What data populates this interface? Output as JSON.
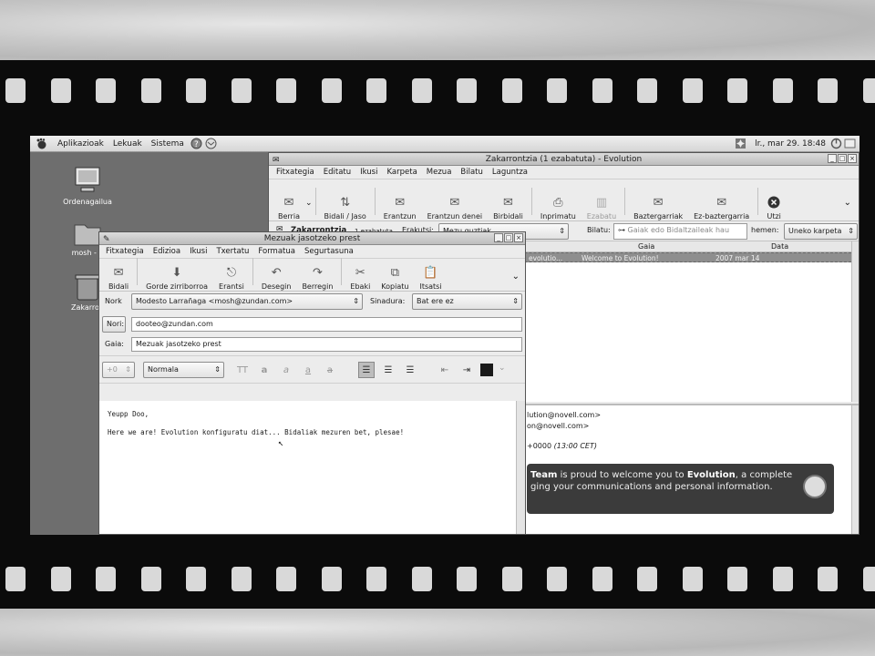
{
  "panel": {
    "menus": [
      "Aplikazioak",
      "Lekuak",
      "Sistema"
    ],
    "clock": "lr., mar 29. 18:48"
  },
  "desktop": {
    "icons": [
      "Ordenagailua",
      "mosh - e",
      "Zakarron"
    ]
  },
  "evolution": {
    "title": "Zakarrontzia (1 ezabatuta) - Evolution",
    "menu": [
      "Fitxategia",
      "Editatu",
      "Ikusi",
      "Karpeta",
      "Mezua",
      "Bilatu",
      "Laguntza"
    ],
    "toolbar": [
      "Berria",
      "Bidali / Jaso",
      "Erantzun",
      "Erantzun denei",
      "Birbidali",
      "Inprimatu",
      "Ezabatu",
      "Baztergarriak",
      "Ez-baztergarria",
      "Utzi"
    ],
    "folder": {
      "name": "Zakarrontzia",
      "count": "1 ezabatuta",
      "show_label": "Erakutsi:",
      "show_value": "Mezu guztiak",
      "search_label": "Bilatu:",
      "search_placeholder": "Gaiak edo Bidaltzaileak hau",
      "in_label": "hemen:",
      "in_value": "Uneko karpeta"
    },
    "columns": [
      "Gaia",
      "Data"
    ],
    "message_row": {
      "from": "evolutio...",
      "subject": "Welcome to Evolution!",
      "date": "2007 mar 14"
    },
    "preview": {
      "from_fragment": "lution@novell.com>",
      "to_fragment": "on@novell.com>",
      "date_fragment": "+0000",
      "date_local": "(13:00 CET)",
      "welcome_line1_a": "Team",
      "welcome_line1_b": "is proud to welcome you to",
      "welcome_line1_c": "Evolution",
      "welcome_line1_d": ", a complete",
      "welcome_line2": "ging your communications and personal information."
    }
  },
  "composer": {
    "title": "Mezuak jasotzeko prest",
    "menu": [
      "Fitxategia",
      "Edizioa",
      "Ikusi",
      "Txertatu",
      "Formatua",
      "Segurtasuna"
    ],
    "toolbar": [
      "Bidali",
      "Gorde zirriborroa",
      "Erantsi",
      "Desegin",
      "Berregin",
      "Ebaki",
      "Kopiatu",
      "Itsatsi"
    ],
    "from_label": "Nork",
    "from_value": "Modesto Larrañaga <mosh@zundan.com>",
    "signature_label": "Sinadura:",
    "signature_value": "Bat ere ez",
    "to_label": "Nori:",
    "to_value": "dooteo@zundan.com",
    "subject_label": "Gaia:",
    "subject_value": "Mezuak jasotzeko prest",
    "font_size": "+0",
    "paragraph_style": "Normala",
    "body_line1": "Yeupp Doo,",
    "body_line2": "Here we are! Evolution konfiguratu diat... Bidaliak mezuren bet, plesae!"
  },
  "colors": {
    "film": "#0b0b0b",
    "desktop": "#6e6e6e",
    "welcome_bg": "#3b3b3b"
  }
}
